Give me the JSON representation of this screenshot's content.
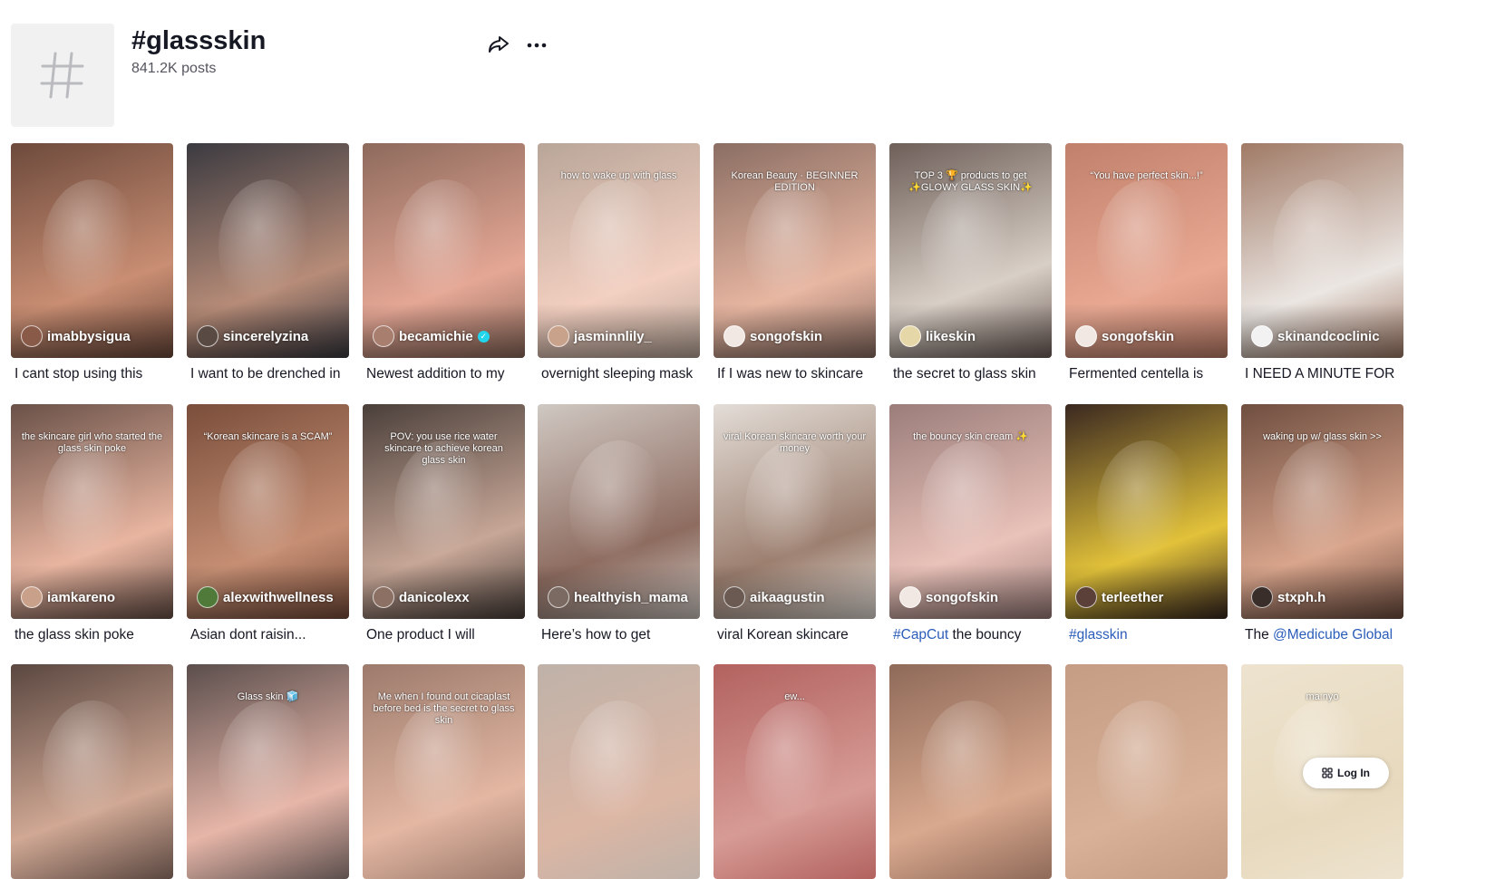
{
  "header": {
    "title": "#glassskin",
    "posts": "841.2K posts"
  },
  "videos": [
    {
      "author": "imabbysigua",
      "caption": "I cant stop using this",
      "overlay": "",
      "verified": false,
      "colors": [
        "#6d4a3c",
        "#c98e73"
      ],
      "avatar": "#8a5a48"
    },
    {
      "author": "sincerelyzina",
      "caption": "I want to be drenched in",
      "overlay": "",
      "verified": false,
      "colors": [
        "#3b3a40",
        "#b78c78"
      ],
      "avatar": "#5a4a44"
    },
    {
      "author": "becamichie",
      "caption": "Newest addition to my",
      "overlay": "",
      "verified": true,
      "colors": [
        "#8d6a5c",
        "#e5a795"
      ],
      "avatar": "#a87e6e"
    },
    {
      "author": "jasminnlily_",
      "caption": "overnight sleeping mask",
      "overlay": "how to wake up with glass",
      "verified": false,
      "colors": [
        "#b9a699",
        "#f2cfc0"
      ],
      "avatar": "#c9a28b"
    },
    {
      "author": "songofskin",
      "caption": "If I was new to skincare",
      "overlay": "Korean Beauty · BEGINNER EDITION",
      "verified": false,
      "colors": [
        "#8b6e63",
        "#e7b6a1"
      ],
      "avatar": "#f2e8e3"
    },
    {
      "author": "likeskin",
      "caption": "the secret to glass skin",
      "overlay": "TOP 3 🏆 products to get ✨GLOWY GLASS SKIN✨",
      "verified": false,
      "colors": [
        "#6e5f59",
        "#d8cfc6"
      ],
      "avatar": "#e6d7a8"
    },
    {
      "author": "songofskin",
      "caption": "Fermented centella is",
      "overlay": "“You have perfect skin...!”",
      "verified": false,
      "colors": [
        "#c0806b",
        "#e8a892"
      ],
      "avatar": "#f2e8e3"
    },
    {
      "author": "skinandcoclinic",
      "caption": "I NEED A MINUTE FOR",
      "overlay": "",
      "verified": false,
      "colors": [
        "#a07a66",
        "#ebe6e2"
      ],
      "avatar": "#f2f2f2"
    },
    {
      "author": "iamkareno",
      "caption": "the glass skin poke",
      "overlay": "the skincare girl who started the glass skin poke",
      "verified": false,
      "colors": [
        "#6a5148",
        "#e8b5a0"
      ],
      "avatar": "#c9a08a"
    },
    {
      "author": "alexwithwellness",
      "caption": "Asian dont raisin...",
      "overlay": "“Korean skincare is a SCAM”",
      "verified": false,
      "colors": [
        "#7a4e3b",
        "#c68f74"
      ],
      "avatar": "#4f7a3a"
    },
    {
      "author": "danicolexx",
      "caption": "One product I will",
      "overlay": "POV: you use rice water skincare to achieve korean glass skin",
      "verified": false,
      "colors": [
        "#4a3f3a",
        "#c7a797"
      ],
      "avatar": "#8c7064"
    },
    {
      "author": "healthyish_mama",
      "caption": "Here’s how to get",
      "overlay": "",
      "verified": false,
      "colors": [
        "#cfc8c2",
        "#8e6c60"
      ],
      "avatar": "#7a6a62"
    },
    {
      "author": "aikaagustin",
      "caption": "viral Korean skincare",
      "overlay": "viral Korean skincare worth your money",
      "verified": false,
      "colors": [
        "#e3ddd7",
        "#9c7f6f"
      ],
      "avatar": "#6a5a52"
    },
    {
      "author": "songofskin",
      "caption_tag": "#CapCut",
      "caption": " the bouncy",
      "overlay": "the bouncy skin cream ✨",
      "verified": false,
      "colors": [
        "#9b7d7a",
        "#e9c2b9"
      ],
      "avatar": "#f2e8e3"
    },
    {
      "author": "terleether",
      "caption_tag": "#glasskin",
      "caption": "",
      "overlay": "",
      "verified": false,
      "colors": [
        "#3a2820",
        "#e2c23a"
      ],
      "avatar": "#5a4038"
    },
    {
      "author": "stxph.h",
      "caption_prefix": "The ",
      "caption_tag": "@Medicube Global",
      "caption": "",
      "overlay": "waking up w/ glass skin >>",
      "verified": false,
      "colors": [
        "#6f4e40",
        "#d9a58c"
      ],
      "avatar": "#3a2e2a"
    },
    {
      "author": "",
      "caption": "",
      "overlay": "",
      "verified": false,
      "colors": [
        "#5a4740",
        "#d0a894"
      ],
      "avatar": ""
    },
    {
      "author": "",
      "caption": "",
      "overlay": "Glass skin 🧊",
      "verified": false,
      "colors": [
        "#5b4e4c",
        "#e6b6a8"
      ],
      "avatar": ""
    },
    {
      "author": "",
      "caption": "",
      "overlay": "Me when I found out cicaplast before bed is the secret to glass skin",
      "verified": false,
      "colors": [
        "#9c7a6c",
        "#e3b7a2"
      ],
      "avatar": ""
    },
    {
      "author": "",
      "caption": "",
      "overlay": "",
      "verified": false,
      "colors": [
        "#bfb2a9",
        "#dcb6a4"
      ],
      "avatar": ""
    },
    {
      "author": "",
      "caption": "",
      "overlay": "ew...",
      "verified": false,
      "colors": [
        "#b2625f",
        "#d79b95"
      ],
      "avatar": ""
    },
    {
      "author": "",
      "caption": "",
      "overlay": "",
      "verified": false,
      "colors": [
        "#8f6a59",
        "#d9a98e"
      ],
      "avatar": ""
    },
    {
      "author": "",
      "caption": "",
      "overlay": "",
      "verified": false,
      "colors": [
        "#c59c84",
        "#d8b198"
      ],
      "avatar": ""
    },
    {
      "author": "",
      "caption": "",
      "overlay": "ma:nyo",
      "verified": false,
      "colors": [
        "#ede3cf",
        "#e7d9bd"
      ],
      "avatar": ""
    }
  ],
  "login": {
    "label": "Log In"
  },
  "icons": {
    "share": "share-icon",
    "more": "more-icon",
    "hashtag": "hashtag-icon",
    "login": "login-icon"
  }
}
